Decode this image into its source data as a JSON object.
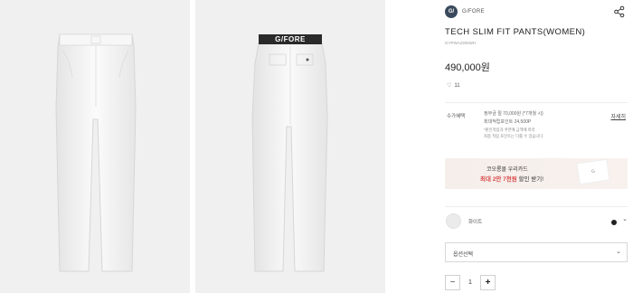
{
  "brand": {
    "name": "G/FORE",
    "logo_text": "G/"
  },
  "product": {
    "title": "TECH SLIM FIT PANTS(WOMEN)",
    "sku": "GYPWA2305WH",
    "price": "490,000원",
    "likes": "11",
    "waistband_text": "G/FORE"
  },
  "benefits": {
    "label": "수가혜택",
    "more": "자세히",
    "line1": "정부금 절 70,000원 (*7개월 시)",
    "line2": "최대적립포인트 24,500P",
    "line3": "*판인적립과 쿠폰에 금액에 따라",
    "line4": "최종 적립 포인트는 다를 수 있습니다."
  },
  "banner": {
    "line1": "코오롱몰 우리카드",
    "line2_prefix": "최대 2만 7천원",
    "line2_suffix": " 할인 받기!",
    "card_text": "G"
  },
  "color": {
    "name": "화이트",
    "swatch_color": "#ebebeb"
  },
  "option": {
    "placeholder": "옵션선택"
  },
  "quantity": {
    "minus": "−",
    "value": "1",
    "plus": "+"
  },
  "icons": {
    "share": "share-icon",
    "heart": "heart-icon",
    "chevron": "chevron-down-icon"
  }
}
